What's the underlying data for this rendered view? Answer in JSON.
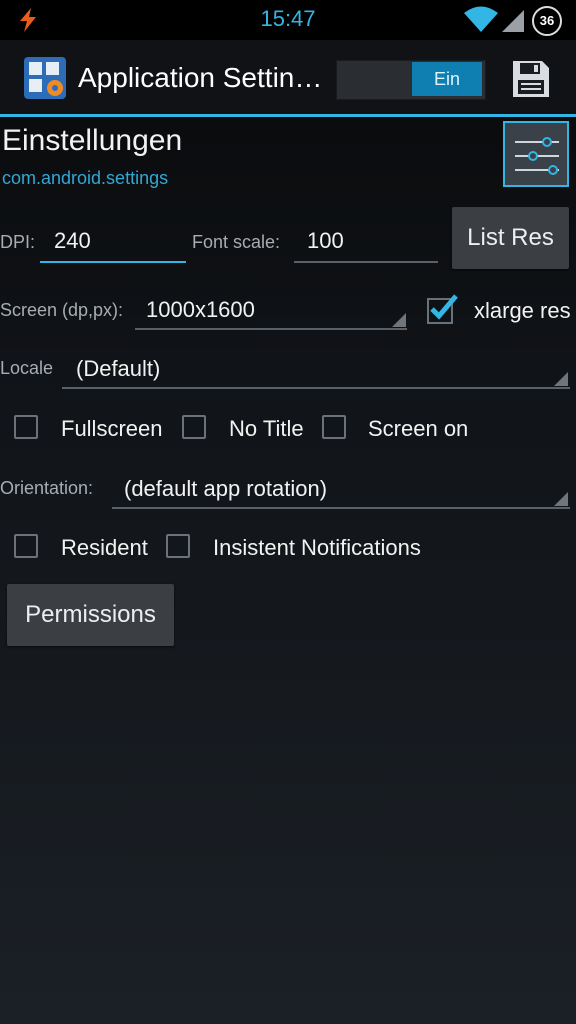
{
  "status_bar": {
    "time": "15:47",
    "battery_level": "36"
  },
  "action_bar": {
    "title": "Application Settin…",
    "toggle_label": "Ein"
  },
  "header": {
    "app_name": "Einstellungen",
    "package": "com.android.settings"
  },
  "dpi": {
    "label": "DPI:",
    "value": "240"
  },
  "font_scale": {
    "label": "Font scale:",
    "value": "100"
  },
  "list_res_button": "List Res",
  "screen": {
    "label": "Screen (dp,px):",
    "value": "1000x1600",
    "xlarge_label": "xlarge res",
    "xlarge_checked": true
  },
  "locale": {
    "label": "Locale",
    "value": "(Default)"
  },
  "checkboxes_row1": [
    {
      "label": "Fullscreen",
      "checked": false
    },
    {
      "label": "No Title",
      "checked": false
    },
    {
      "label": "Screen on",
      "checked": false
    }
  ],
  "orientation": {
    "label": "Orientation:",
    "value": "(default app rotation)"
  },
  "checkboxes_row2": [
    {
      "label": "Resident",
      "checked": false
    },
    {
      "label": "Insistent Notifications",
      "checked": false
    }
  ],
  "permissions_button": "Permissions",
  "colors": {
    "accent": "#33b5e5",
    "background": "#101317",
    "button": "#3b3e43"
  }
}
